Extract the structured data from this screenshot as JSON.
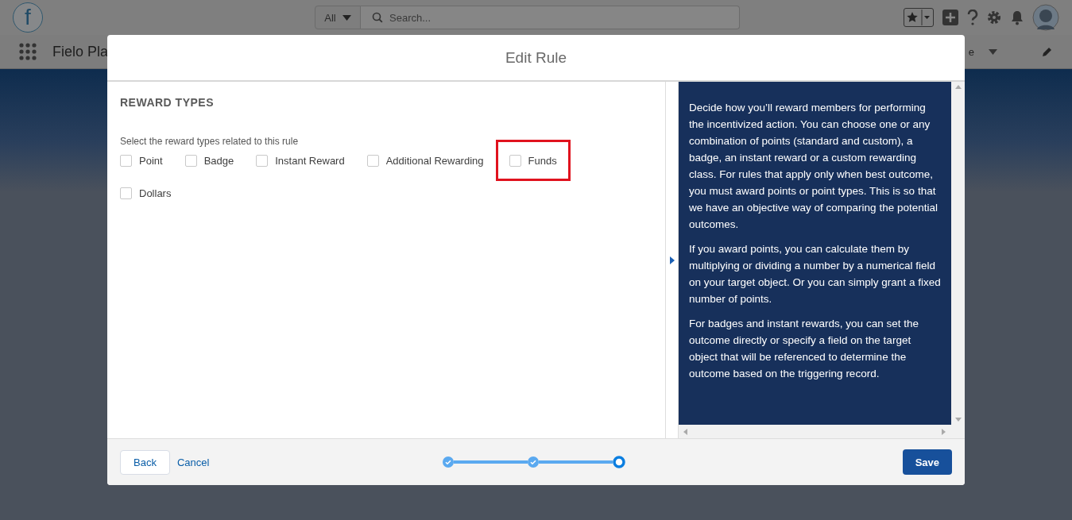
{
  "header": {
    "logo": "f",
    "search_scope": "All",
    "search": {
      "placeholder": "Search..."
    }
  },
  "nav": {
    "app_name": "Fielo Pla",
    "tab_fragment": "e"
  },
  "modal": {
    "title": "Edit Rule",
    "section_title": "REWARD TYPES",
    "instruction": "Select the reward types related to this rule",
    "reward_types": [
      {
        "label": "Point",
        "checked": false,
        "highlighted": false
      },
      {
        "label": "Badge",
        "checked": false,
        "highlighted": false
      },
      {
        "label": "Instant Reward",
        "checked": false,
        "highlighted": false
      },
      {
        "label": "Additional Rewarding",
        "checked": false,
        "highlighted": false
      },
      {
        "label": "Funds",
        "checked": false,
        "highlighted": true
      },
      {
        "label": "Dollars",
        "checked": false,
        "highlighted": false
      }
    ],
    "help": [
      "Decide how you’ll reward members for performing the incentivized action. You can choose one or any combination of points (standard and custom), a badge, an instant reward or a custom rewarding class. For rules that apply only when best outcome, you must award points or point types. This is so that we have an objective way of comparing the potential outcomes.",
      "If you award points, you can calculate them by multiplying or dividing a number by a numerical field on your target object. Or you can simply grant a fixed number of points.",
      "For badges and instant rewards, you can set the outcome directly or specify a field on the target object that will be referenced to determine the outcome based on the triggering record."
    ],
    "footer": {
      "back": "Back",
      "cancel": "Cancel",
      "save": "Save",
      "steps": [
        {
          "completed": true
        },
        {
          "completed": true
        },
        {
          "completed": false
        }
      ]
    }
  }
}
